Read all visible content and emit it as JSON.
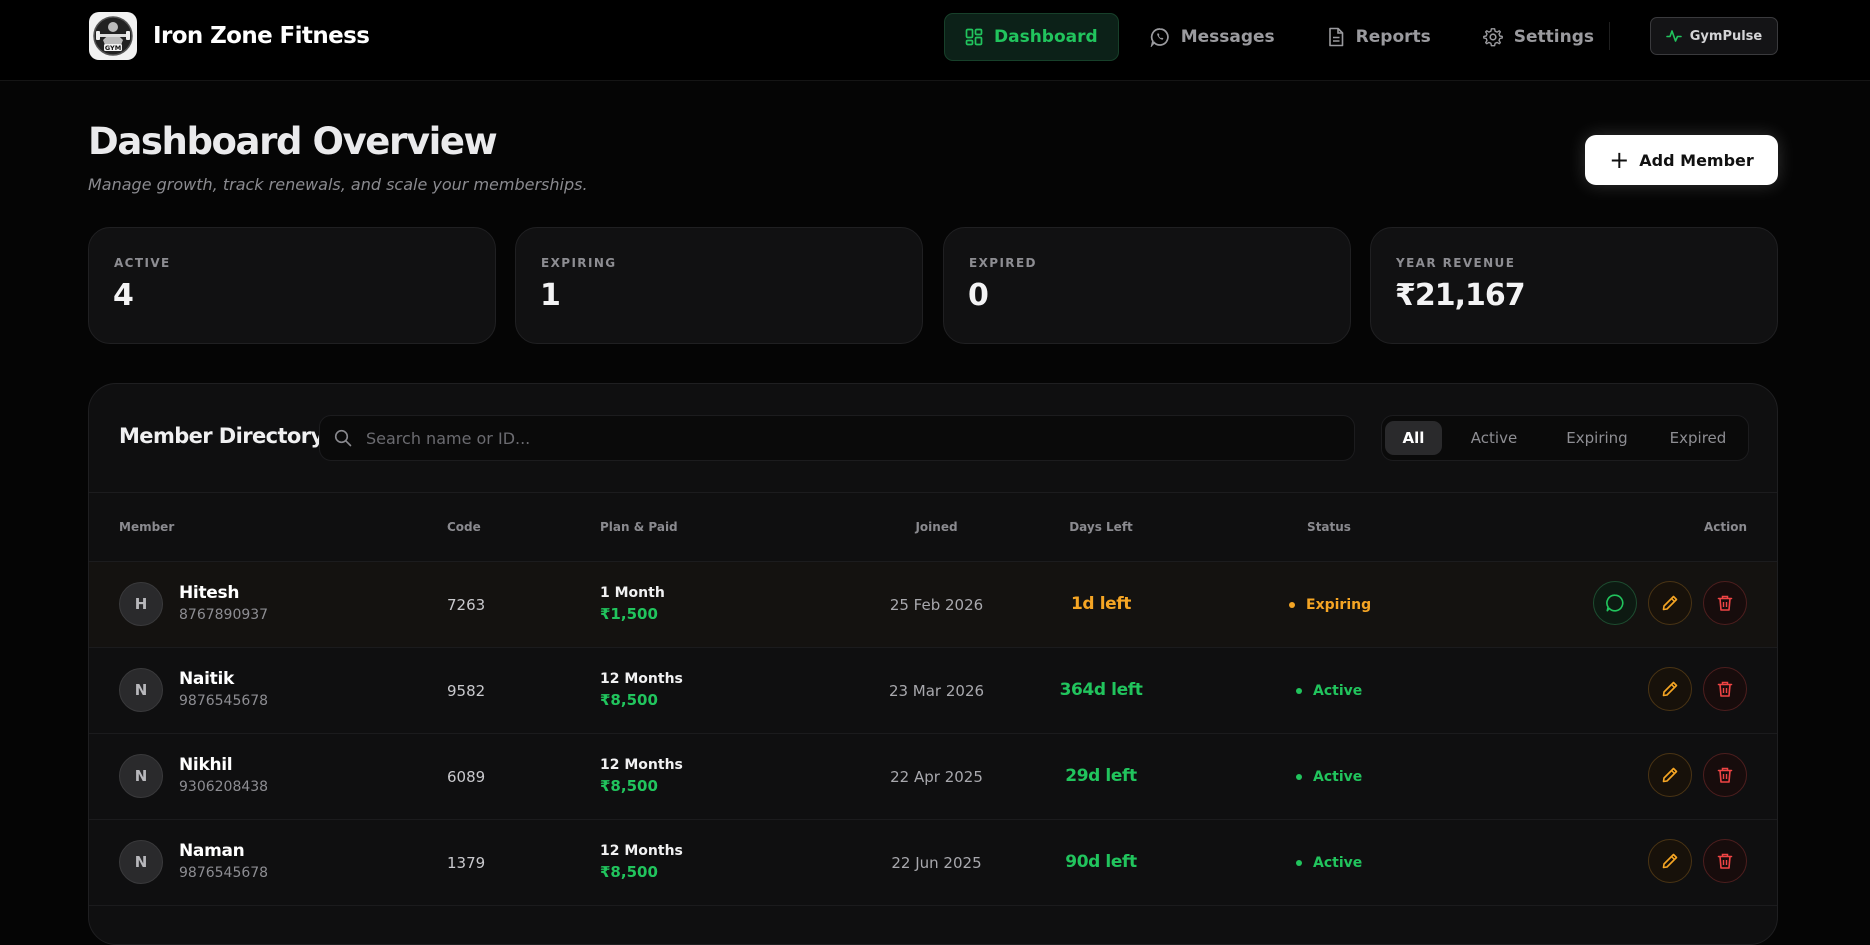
{
  "app": {
    "name": "Iron Zone Fitness",
    "logo_text": "GYM"
  },
  "nav": {
    "items": [
      {
        "label": "Dashboard",
        "icon": "dashboard-grid-icon",
        "active": true
      },
      {
        "label": "Messages",
        "icon": "whatsapp-icon",
        "active": false
      },
      {
        "label": "Reports",
        "icon": "document-icon",
        "active": false
      },
      {
        "label": "Settings",
        "icon": "gear-icon",
        "active": false
      }
    ],
    "badge": {
      "label": "GymPulse",
      "icon": "pulse-icon"
    }
  },
  "header": {
    "title": "Dashboard Overview",
    "subtitle": "Manage growth, track renewals, and scale your memberships.",
    "add_button": "Add Member"
  },
  "stats": [
    {
      "label": "ACTIVE",
      "value": "4"
    },
    {
      "label": "EXPIRING",
      "value": "1"
    },
    {
      "label": "EXPIRED",
      "value": "0"
    },
    {
      "label": "YEAR REVENUE",
      "value": "₹21,167"
    }
  ],
  "directory": {
    "title": "Member Directory",
    "search_placeholder": "Search name or ID...",
    "filters": [
      {
        "label": "All",
        "active": true
      },
      {
        "label": "Active",
        "active": false
      },
      {
        "label": "Expiring",
        "active": false
      },
      {
        "label": "Expired",
        "active": false
      }
    ],
    "columns": {
      "member": "Member",
      "code": "Code",
      "plan": "Plan & Paid",
      "joined": "Joined",
      "days": "Days Left",
      "status": "Status",
      "action": "Action"
    },
    "rows": [
      {
        "initial": "H",
        "name": "Hitesh",
        "phone": "8767890937",
        "code": "7263",
        "plan": "1 Month",
        "paid": "₹1,500",
        "joined": "25 Feb 2026",
        "days_left": "1d left",
        "status": "Expiring"
      },
      {
        "initial": "N",
        "name": "Naitik",
        "phone": "9876545678",
        "code": "9582",
        "plan": "12 Months",
        "paid": "₹8,500",
        "joined": "23 Mar 2026",
        "days_left": "364d left",
        "status": "Active"
      },
      {
        "initial": "N",
        "name": "Nikhil",
        "phone": "9306208438",
        "code": "6089",
        "plan": "12 Months",
        "paid": "₹8,500",
        "joined": "22 Apr 2025",
        "days_left": "29d left",
        "status": "Active"
      },
      {
        "initial": "N",
        "name": "Naman",
        "phone": "9876545678",
        "code": "1379",
        "plan": "12 Months",
        "paid": "₹8,500",
        "joined": "22 Jun 2025",
        "days_left": "90d left",
        "status": "Active"
      }
    ]
  },
  "colors": {
    "accent_green": "#21c45d",
    "warning_orange": "#f5a524",
    "danger_red": "#ef4444",
    "background": "#050505"
  }
}
